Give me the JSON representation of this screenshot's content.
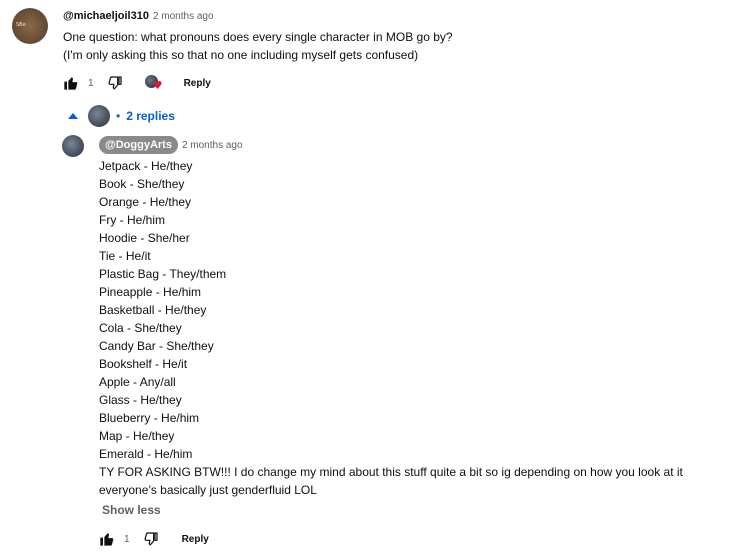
{
  "top_comment": {
    "author": "@michaeljoil310",
    "time": "2 months ago",
    "avatar_text": "SBe",
    "text_lines": [
      "One question: what pronouns does every single character in MOB go by?",
      "(I'm only asking this so that no one including myself gets confused)"
    ],
    "like_count": "1",
    "reply_label": "Reply"
  },
  "replies": {
    "count_label": "2 replies",
    "separator": "•"
  },
  "reply": {
    "author": "@DoggyArts",
    "time": "2 months ago",
    "lines": [
      "Jetpack - He/they",
      "Book - She/they",
      "Orange - He/they",
      "Fry - He/him",
      "Hoodie - She/her",
      "Tie - He/it",
      "Plastic Bag - They/them",
      "Pineapple - He/him",
      "Basketball - He/they",
      "Cola - She/they",
      "Candy Bar - She/they",
      "Bookshelf - He/it",
      "Apple - Any/all",
      "Glass - He/they",
      "Blueberry - He/him",
      "Map - He/they",
      "Emerald - He/him"
    ],
    "closing": "TY FOR ASKING BTW!!! I do change my mind about this stuff quite a bit so ig depending on how you look at it everyone’s basically just genderfluid LOL",
    "show_less_label": "Show less",
    "like_count": "1",
    "reply_label": "Reply"
  },
  "icons": {
    "like": "thumbs-up-icon",
    "dislike": "thumbs-down-icon",
    "collapse": "chevron-up-icon",
    "creator_heart": "heart-icon"
  },
  "colors": {
    "link_blue": "#065fd4",
    "heart_red": "#e0182a",
    "secondary_text": "#606060",
    "handle_pill": "#8a8a8a"
  }
}
